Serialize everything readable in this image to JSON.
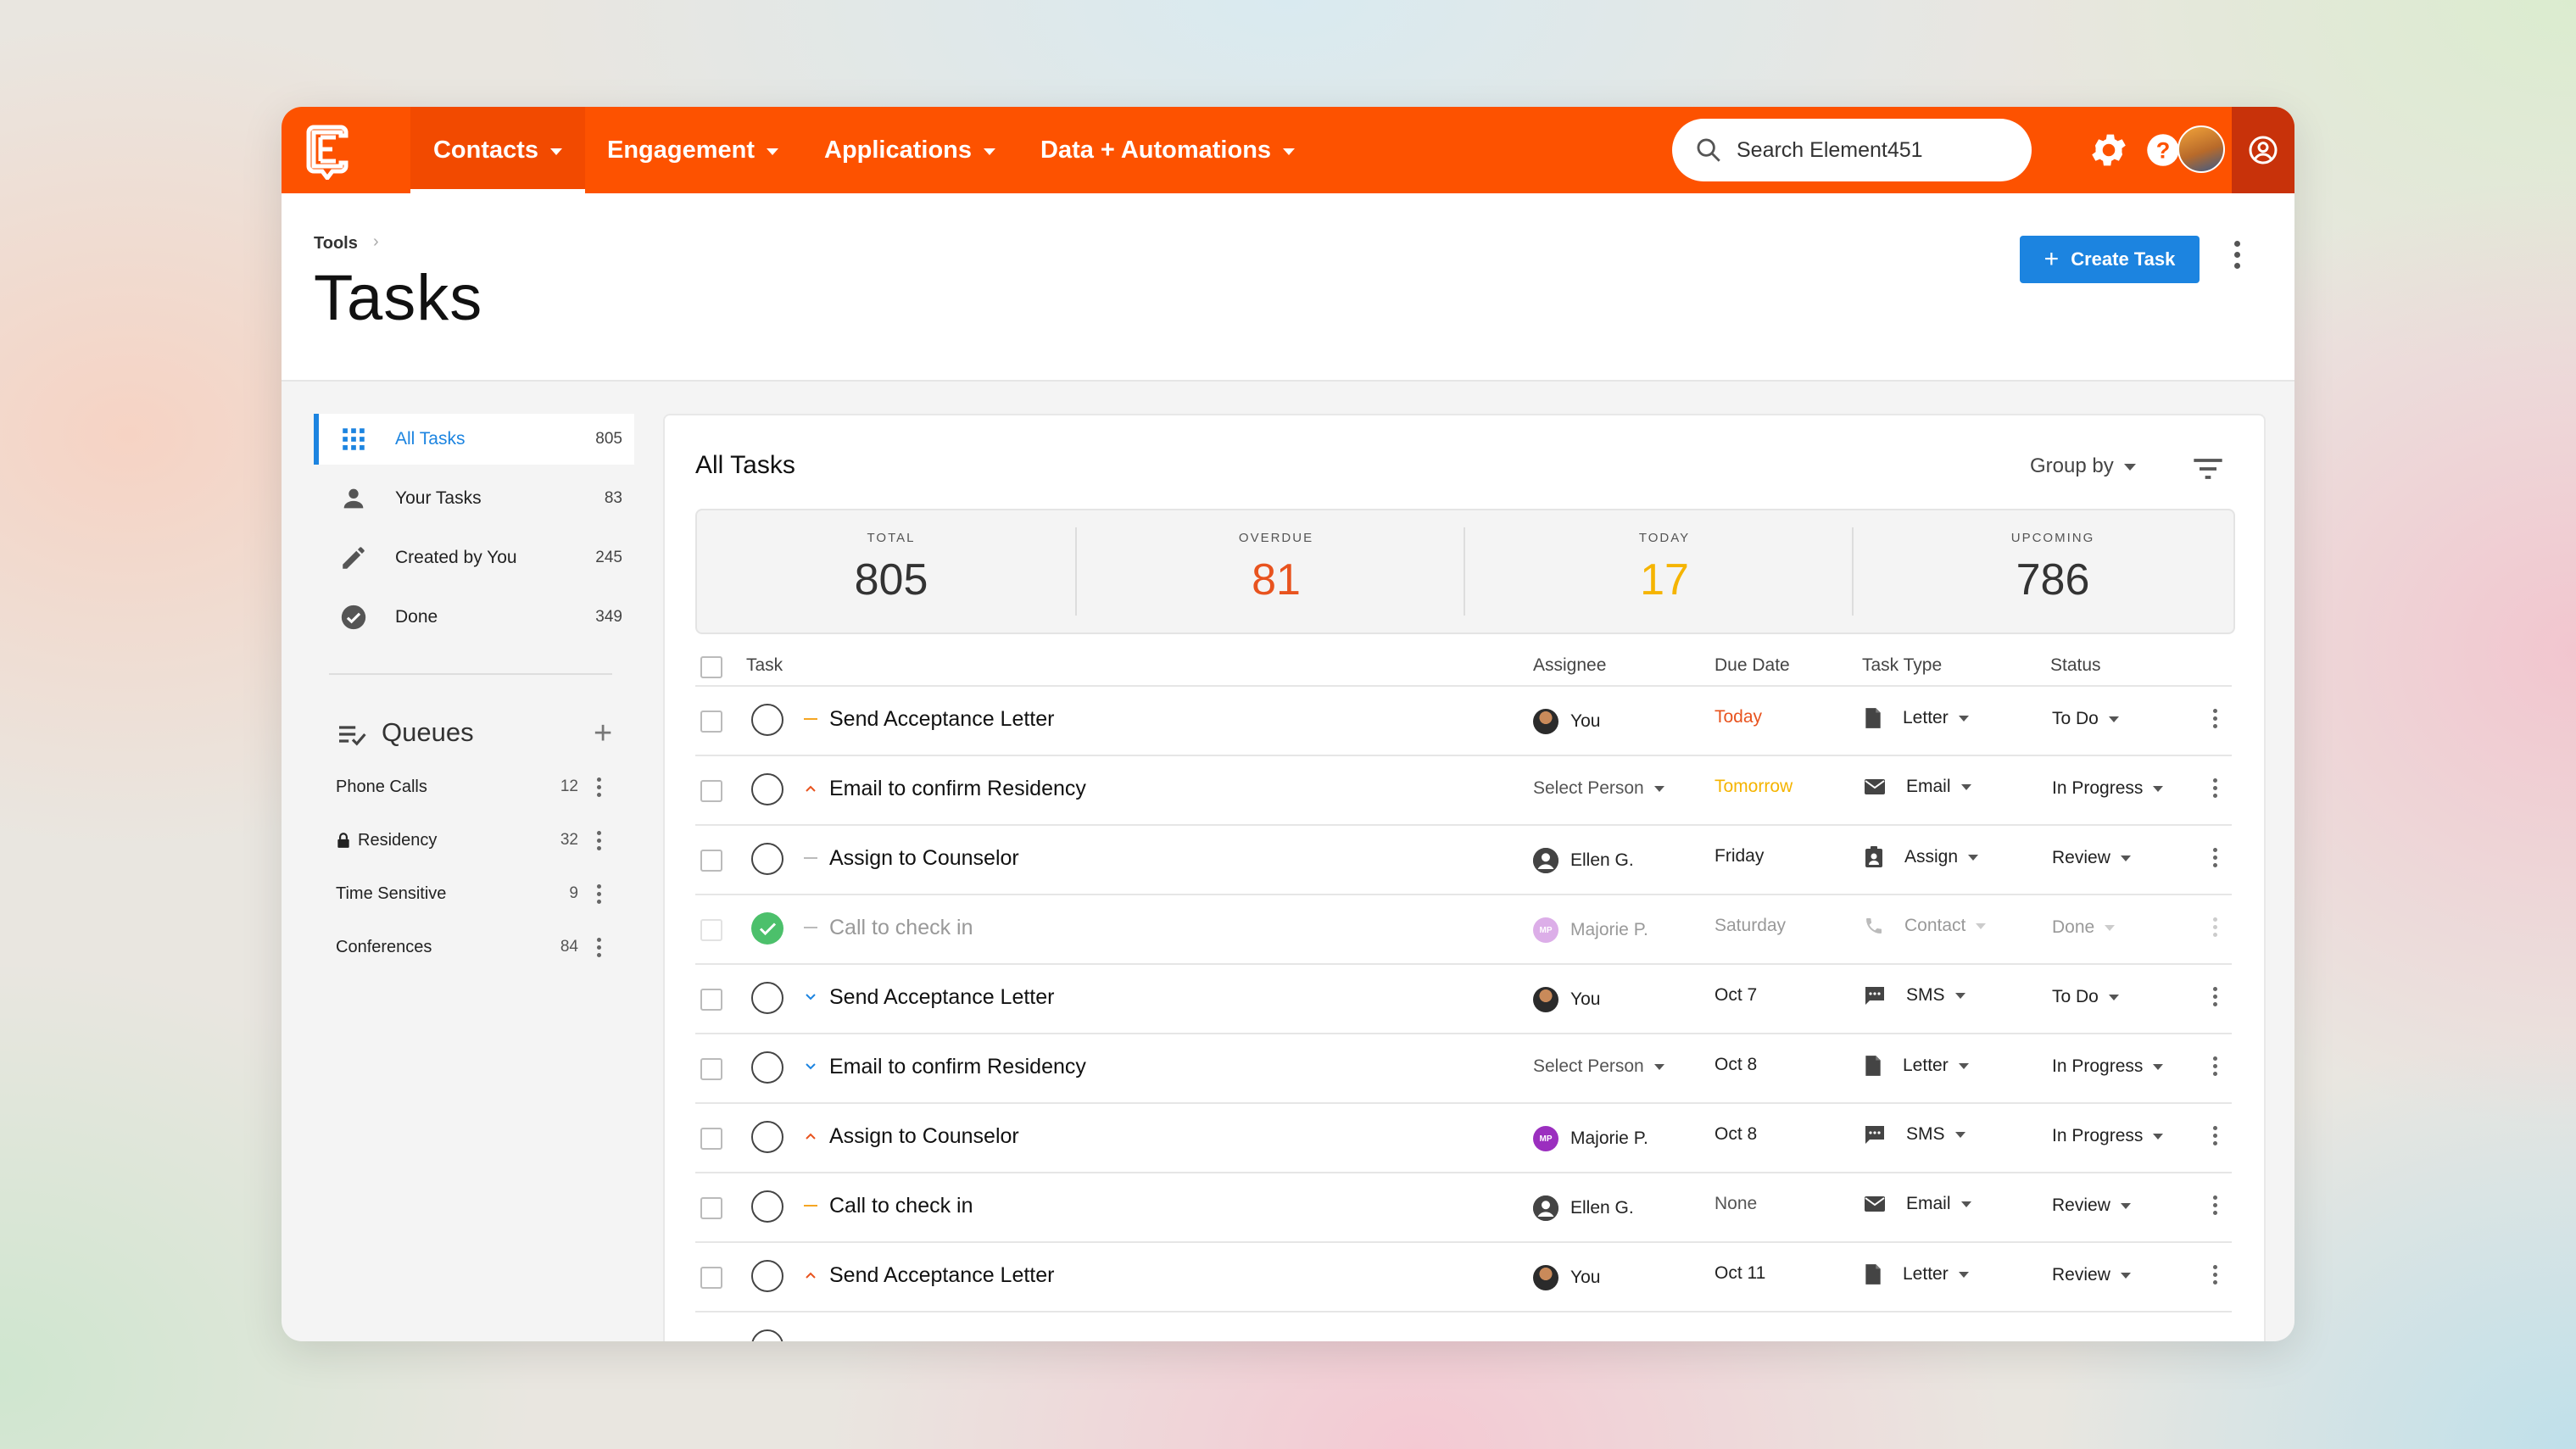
{
  "app": {
    "search_placeholder": "Search Element451",
    "logo_letter": "E"
  },
  "nav": [
    {
      "label": "Contacts",
      "active": true
    },
    {
      "label": "Engagement"
    },
    {
      "label": "Applications"
    },
    {
      "label": "Data + Automations"
    }
  ],
  "header": {
    "breadcrumb": "Tools",
    "title": "Tasks",
    "create_label": "Create Task"
  },
  "sidebar": {
    "items": [
      {
        "label": "All Tasks",
        "count": "805",
        "icon": "grid-icon",
        "active": true
      },
      {
        "label": "Your Tasks",
        "count": "83",
        "icon": "person-icon"
      },
      {
        "label": "Created by You",
        "count": "245",
        "icon": "pencil-icon"
      },
      {
        "label": "Done",
        "count": "349",
        "icon": "check-circle-icon"
      }
    ],
    "queues_title": "Queues",
    "queues": [
      {
        "label": "Phone Calls",
        "count": "12"
      },
      {
        "label": "Residency",
        "count": "32",
        "locked": true
      },
      {
        "label": "Time Sensitive",
        "count": "9"
      },
      {
        "label": "Conferences",
        "count": "84"
      }
    ]
  },
  "main": {
    "title": "All Tasks",
    "group_by": "Group by",
    "stats": [
      {
        "label": "TOTAL",
        "value": "805",
        "color": "#333333"
      },
      {
        "label": "OVERDUE",
        "value": "81",
        "color": "#e8531e"
      },
      {
        "label": "TODAY",
        "value": "17",
        "color": "#f5b400"
      },
      {
        "label": "UPCOMING",
        "value": "786",
        "color": "#333333"
      }
    ],
    "columns": {
      "task": "Task",
      "assignee": "Assignee",
      "due": "Due Date",
      "type": "Task Type",
      "status": "Status"
    },
    "rows": [
      {
        "name": "Send Acceptance Letter",
        "priority": "medium",
        "assignee": "You",
        "avatar": "photo",
        "due": "Today",
        "due_color": "#e8531e",
        "type": "Letter",
        "type_icon": "letter-icon",
        "status": "To Do"
      },
      {
        "name": "Email to confirm Residency",
        "priority": "high",
        "assignee": "Select Person",
        "avatar": "none",
        "due": "Tomorrow",
        "due_color": "#f5b400",
        "type": "Email",
        "type_icon": "email-icon",
        "status": "In Progress"
      },
      {
        "name": "Assign to Counselor",
        "priority": "none",
        "assignee": "Ellen G.",
        "avatar": "generic",
        "due": "Friday",
        "due_color": "#222222",
        "type": "Assign",
        "type_icon": "assign-icon",
        "status": "Review"
      },
      {
        "name": "Call to check in",
        "priority": "none",
        "assignee": "Majorie P.",
        "avatar": "initials",
        "initials": "MP",
        "due": "Saturday",
        "due_color": "#999999",
        "type": "Contact",
        "type_icon": "phone-icon",
        "status": "Done",
        "done": true
      },
      {
        "name": "Send Acceptance Letter",
        "priority": "low",
        "assignee": "You",
        "avatar": "photo",
        "due": "Oct 7",
        "due_color": "#222222",
        "type": "SMS",
        "type_icon": "sms-icon",
        "status": "To Do"
      },
      {
        "name": "Email to confirm Residency",
        "priority": "low",
        "assignee": "Select Person",
        "avatar": "none",
        "due": "Oct 8",
        "due_color": "#222222",
        "type": "Letter",
        "type_icon": "letter-icon",
        "status": "In Progress"
      },
      {
        "name": "Assign to Counselor",
        "priority": "high",
        "assignee": "Majorie P.",
        "avatar": "initials",
        "initials": "MP",
        "due": "Oct 8",
        "due_color": "#222222",
        "type": "SMS",
        "type_icon": "sms-icon",
        "status": "In Progress"
      },
      {
        "name": "Call to check in",
        "priority": "medium",
        "assignee": "Ellen G.",
        "avatar": "generic",
        "due": "None",
        "due_color": "#555555",
        "type": "Email",
        "type_icon": "email-icon",
        "status": "Review"
      },
      {
        "name": "Send Acceptance Letter",
        "priority": "high",
        "assignee": "You",
        "avatar": "photo",
        "due": "Oct 11",
        "due_color": "#222222",
        "type": "Letter",
        "type_icon": "letter-icon",
        "status": "Review"
      }
    ]
  },
  "colors": {
    "brand": "#fd5200",
    "accent": "#1c84e0",
    "done_green": "#4cc06b"
  }
}
